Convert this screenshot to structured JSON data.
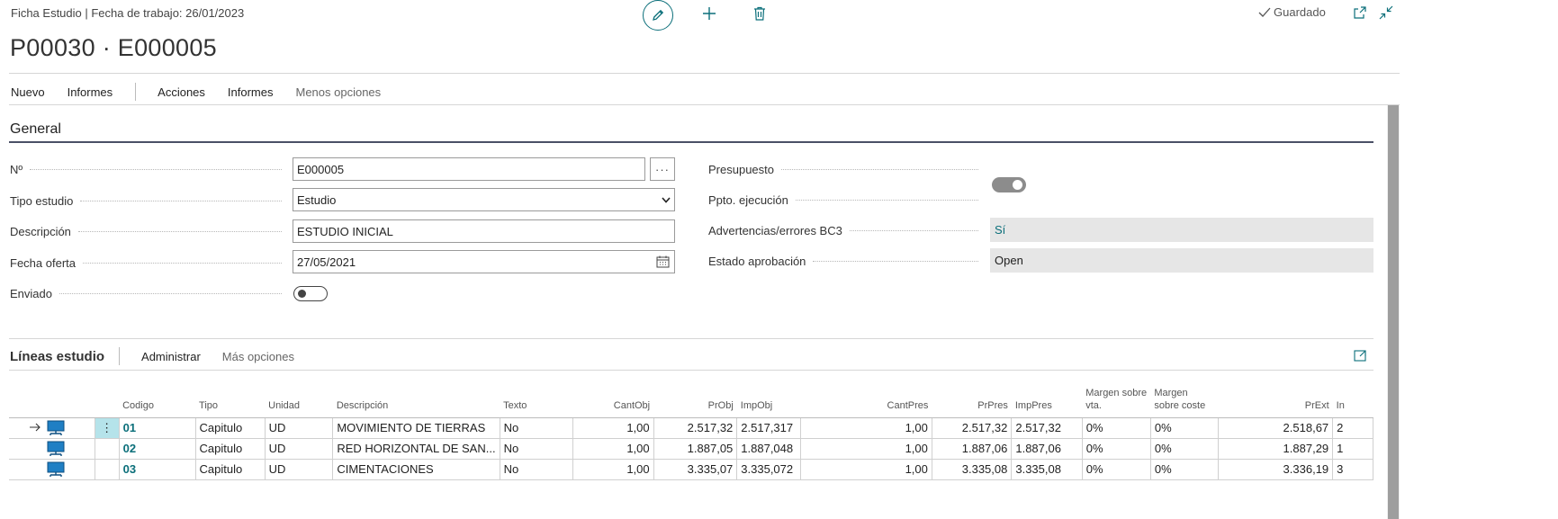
{
  "header": {
    "breadcrumb": "Ficha Estudio | Fecha de trabajo: 26/01/2023",
    "title": "P00030 · E000005",
    "saved_label": "Guardado"
  },
  "actions": {
    "items": [
      "Nuevo",
      "Informes"
    ],
    "items2": [
      "Acciones",
      "Informes"
    ],
    "less_options": "Menos opciones"
  },
  "general": {
    "section_title": "General",
    "fields": {
      "no_label": "Nº",
      "no_value": "E000005",
      "tipo_label": "Tipo estudio",
      "tipo_value": "Estudio",
      "desc_label": "Descripción",
      "desc_value": "ESTUDIO INICIAL",
      "fecha_label": "Fecha oferta",
      "fecha_value": "27/05/2021",
      "enviado_label": "Enviado",
      "presupuesto_label": "Presupuesto",
      "ppto_label": "Ppto. ejecución",
      "advert_label": "Advertencias/errores BC3",
      "advert_value": "Sí",
      "estado_label": "Estado aprobación",
      "estado_value": "Open"
    }
  },
  "lines": {
    "title": "Líneas estudio",
    "manage": "Administrar",
    "more_options": "Más opciones",
    "columns": [
      "Codigo",
      "Tipo",
      "Unidad",
      "Descripción",
      "Texto",
      "CantObj",
      "PrObj",
      "ImpObj",
      "CantPres",
      "PrPres",
      "ImpPres",
      "Margen sobre vta.",
      "Margen sobre coste",
      "PrExt",
      "In"
    ],
    "rows": [
      [
        "01",
        "Capitulo",
        "UD",
        "MOVIMIENTO DE TIERRAS",
        "No",
        "1,00",
        "2.517,32",
        "2.517,317",
        "1,00",
        "2.517,32",
        "2.517,32",
        "0%",
        "0%",
        "2.518,67",
        "2"
      ],
      [
        "02",
        "Capitulo",
        "UD",
        "RED HORIZONTAL DE SAN...",
        "No",
        "1,00",
        "1.887,05",
        "1.887,048",
        "1,00",
        "1.887,06",
        "1.887,06",
        "0%",
        "0%",
        "1.887,29",
        "1"
      ],
      [
        "03",
        "Capitulo",
        "UD",
        "CIMENTACIONES",
        "No",
        "1,00",
        "3.335,07",
        "3.335,072",
        "1,00",
        "3.335,08",
        "3.335,08",
        "0%",
        "0%",
        "3.336,19",
        "3"
      ]
    ]
  },
  "colors": {
    "accent": "#0b6f7a",
    "selected_cell": "#b5e3ea",
    "readonly_bg": "#e6e6e6"
  }
}
